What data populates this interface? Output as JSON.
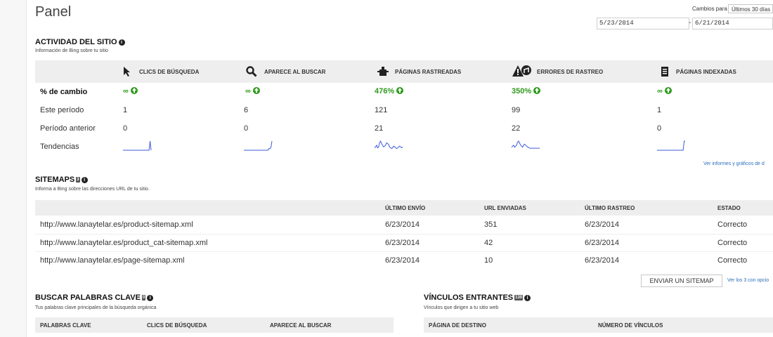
{
  "page": {
    "title": "Panel"
  },
  "date_range": {
    "label": "Cambios para",
    "selected": "Últimos 30 días",
    "start": "5/23/2014",
    "separator": "-",
    "end": "6/21/2014"
  },
  "activity": {
    "title": "ACTIVIDAD DEL SITIO",
    "subtitle": "Información de Bing sobre tu sitio",
    "columns": [
      {
        "label": "CLICS DE BÚSQUEDA",
        "icon": "cursor-icon"
      },
      {
        "label": "APARECE AL BUSCAR",
        "icon": "magnifier-icon"
      },
      {
        "label": "PÁGINAS RASTREADAS",
        "icon": "crawler-icon"
      },
      {
        "label": "ERRORES DE RASTREO",
        "icon": "warning-icon"
      },
      {
        "label": "PÁGINAS INDEXADAS",
        "icon": "document-icon"
      }
    ],
    "rows": {
      "change": {
        "label": "% de cambio",
        "values": [
          "∞",
          "∞",
          "476%",
          "350%",
          "∞"
        ]
      },
      "current": {
        "label": "Este período",
        "values": [
          "1",
          "6",
          "121",
          "99",
          "1"
        ]
      },
      "previous": {
        "label": "Período anterior",
        "values": [
          "0",
          "0",
          "21",
          "22",
          "0"
        ]
      },
      "trends": {
        "label": "Tendencias"
      }
    },
    "trend_color": "#3b5bdb",
    "trend_series": [
      [
        0,
        0,
        0,
        0,
        0,
        0,
        0,
        0,
        0,
        0,
        0,
        0,
        0,
        0,
        0,
        0,
        0,
        0,
        0,
        0,
        0,
        0,
        0,
        0,
        0,
        0,
        0,
        1,
        0
      ],
      [
        0,
        0,
        0,
        0,
        0,
        0,
        0,
        0,
        0,
        0,
        0,
        0,
        0,
        0,
        0,
        0,
        0,
        0,
        0,
        0,
        0,
        0,
        0,
        0,
        0,
        1,
        1,
        2,
        6
      ],
      [
        3,
        4,
        6,
        3,
        4,
        9,
        11,
        8,
        6,
        4,
        5,
        6,
        9,
        8,
        7,
        4,
        3,
        2,
        3,
        5,
        4,
        3,
        2,
        3,
        4,
        5,
        4,
        3,
        4
      ],
      [
        3,
        4,
        5,
        3,
        4,
        5,
        8,
        9,
        7,
        5,
        4,
        3,
        5,
        6,
        5,
        4,
        3,
        3,
        2,
        2,
        2,
        2,
        2,
        2,
        2,
        2,
        2,
        2,
        2
      ],
      [
        0,
        0,
        0,
        0,
        0,
        0,
        0,
        0,
        0,
        0,
        0,
        0,
        0,
        0,
        0,
        0,
        0,
        0,
        0,
        0,
        0,
        0,
        0,
        0,
        0,
        0,
        0,
        1,
        1
      ]
    ],
    "report_link": "Ver informes y gráficos de d"
  },
  "sitemaps": {
    "title": "SITEMAPS",
    "count": "3",
    "subtitle": "Informa a Bing sobre las direcciones URL de tu sitio.",
    "headers": [
      "ÚLTIMO ENVÍO",
      "URL ENVIADAS",
      "ÚLTIMO RASTREO",
      "ESTADO"
    ],
    "rows": [
      {
        "url": "http://www.lanaytelar.es/product-sitemap.xml",
        "sent": "6/23/2014",
        "count": "351",
        "crawl": "6/23/2014",
        "status": "Correcto"
      },
      {
        "url": "http://www.lanaytelar.es/product_cat-sitemap.xml",
        "sent": "6/23/2014",
        "count": "42",
        "crawl": "6/23/2014",
        "status": "Correcto"
      },
      {
        "url": "http://www.lanaytelar.es/page-sitemap.xml",
        "sent": "6/23/2014",
        "count": "10",
        "crawl": "6/23/2014",
        "status": "Correcto"
      }
    ],
    "submit_button": "ENVIAR UN SITEMAP",
    "more_link": "Ver los 3 con opcio"
  },
  "keywords": {
    "title": "BUSCAR PALABRAS CLAVE",
    "count": "0",
    "subtitle": "Tus palabras clave principales de la búsqueda orgánica",
    "headers": [
      "PALABRAS CLAVE",
      "CLICS DE BÚSQUEDA",
      "APARECE AL BUSCAR"
    ]
  },
  "inbound": {
    "title": "VÍNCULOS ENTRANTES",
    "count": "130",
    "subtitle": "Vínculos que dirigen a tu sitio web",
    "headers": [
      "PÁGINA DE DESTINO",
      "NÚMERO DE VÍNCULOS"
    ]
  }
}
